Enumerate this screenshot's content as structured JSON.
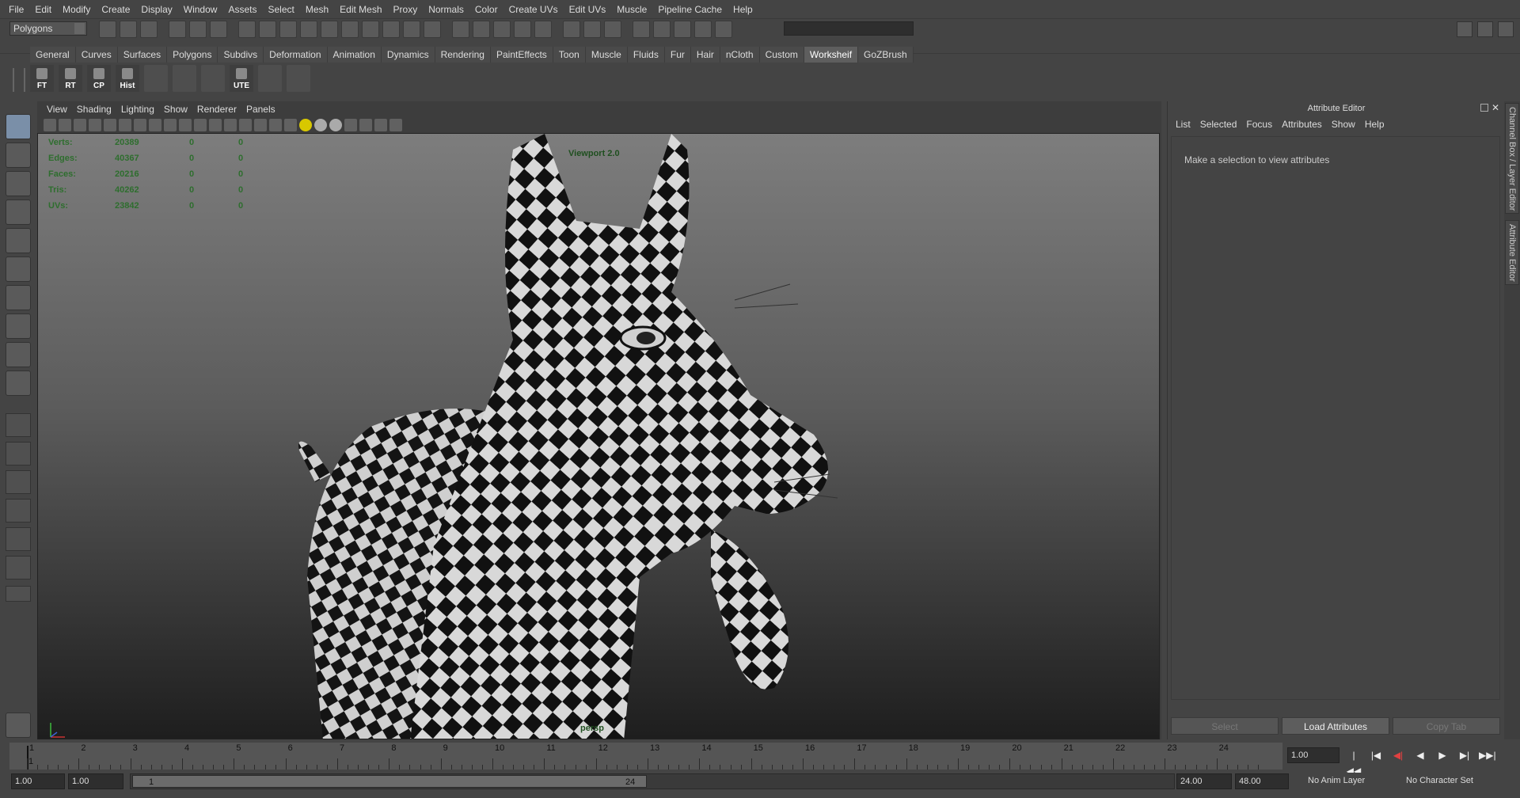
{
  "menubar": [
    "File",
    "Edit",
    "Modify",
    "Create",
    "Display",
    "Window",
    "Assets",
    "Select",
    "Mesh",
    "Edit Mesh",
    "Proxy",
    "Normals",
    "Color",
    "Create UVs",
    "Edit UVs",
    "Muscle",
    "Pipeline Cache",
    "Help"
  ],
  "status": {
    "mode": "Polygons"
  },
  "shelf": {
    "tabs": [
      "General",
      "Curves",
      "Surfaces",
      "Polygons",
      "Subdivs",
      "Deformation",
      "Animation",
      "Dynamics",
      "Rendering",
      "PaintEffects",
      "Toon",
      "Muscle",
      "Fluids",
      "Fur",
      "Hair",
      "nCloth",
      "Custom",
      "Worksheif",
      "GoZBrush"
    ],
    "active_tab": "Worksheif",
    "buttons": [
      "FT",
      "RT",
      "CP",
      "Hist",
      "",
      "",
      "",
      "UTE",
      "",
      ""
    ]
  },
  "panel": {
    "menu": [
      "View",
      "Shading",
      "Lighting",
      "Show",
      "Renderer",
      "Panels"
    ],
    "hud": [
      {
        "label": "Verts:",
        "value": "20389",
        "sel": "0",
        "comp": "0"
      },
      {
        "label": "Edges:",
        "value": "40367",
        "sel": "0",
        "comp": "0"
      },
      {
        "label": "Faces:",
        "value": "20216",
        "sel": "0",
        "comp": "0"
      },
      {
        "label": "Tris:",
        "value": "40262",
        "sel": "0",
        "comp": "0"
      },
      {
        "label": "UVs:",
        "value": "23842",
        "sel": "0",
        "comp": "0"
      }
    ],
    "viewport_label": "Viewport 2.0",
    "camera_label": "persp"
  },
  "attribute_editor": {
    "title": "Attribute Editor",
    "close_glyph": "✕",
    "menu": [
      "List",
      "Selected",
      "Focus",
      "Attributes",
      "Show",
      "Help"
    ],
    "message": "Make a selection to view attributes",
    "buttons": {
      "select": "Select",
      "load": "Load Attributes",
      "copy": "Copy Tab"
    }
  },
  "side_tabs": {
    "channel_box": "Channel Box / Layer Editor",
    "attribute_editor": "Attribute Editor"
  },
  "timeline": {
    "ticks": [
      "1",
      "2",
      "3",
      "4",
      "5",
      "6",
      "7",
      "8",
      "9",
      "10",
      "11",
      "12",
      "13",
      "14",
      "15",
      "16",
      "17",
      "18",
      "19",
      "20",
      "21",
      "22",
      "23",
      "24"
    ],
    "current_frame_label": "1",
    "current_frame": "1.00",
    "playback_glyphs": [
      "|◀◀",
      "|◀",
      "◀|",
      "◀",
      "▶",
      "▶|",
      "▶▶|"
    ]
  },
  "range": {
    "start_outer": "1.00",
    "start_inner": "1.00",
    "slider_start": "1",
    "slider_end": "24",
    "end_inner": "24.00",
    "end_outer": "48.00",
    "anim_layer": "No Anim Layer",
    "character_set": "No Character Set"
  },
  "colors": {
    "hud_green": "#2e6e2e",
    "active_tab": "#5e5e5e",
    "record_red": "#e04040"
  }
}
